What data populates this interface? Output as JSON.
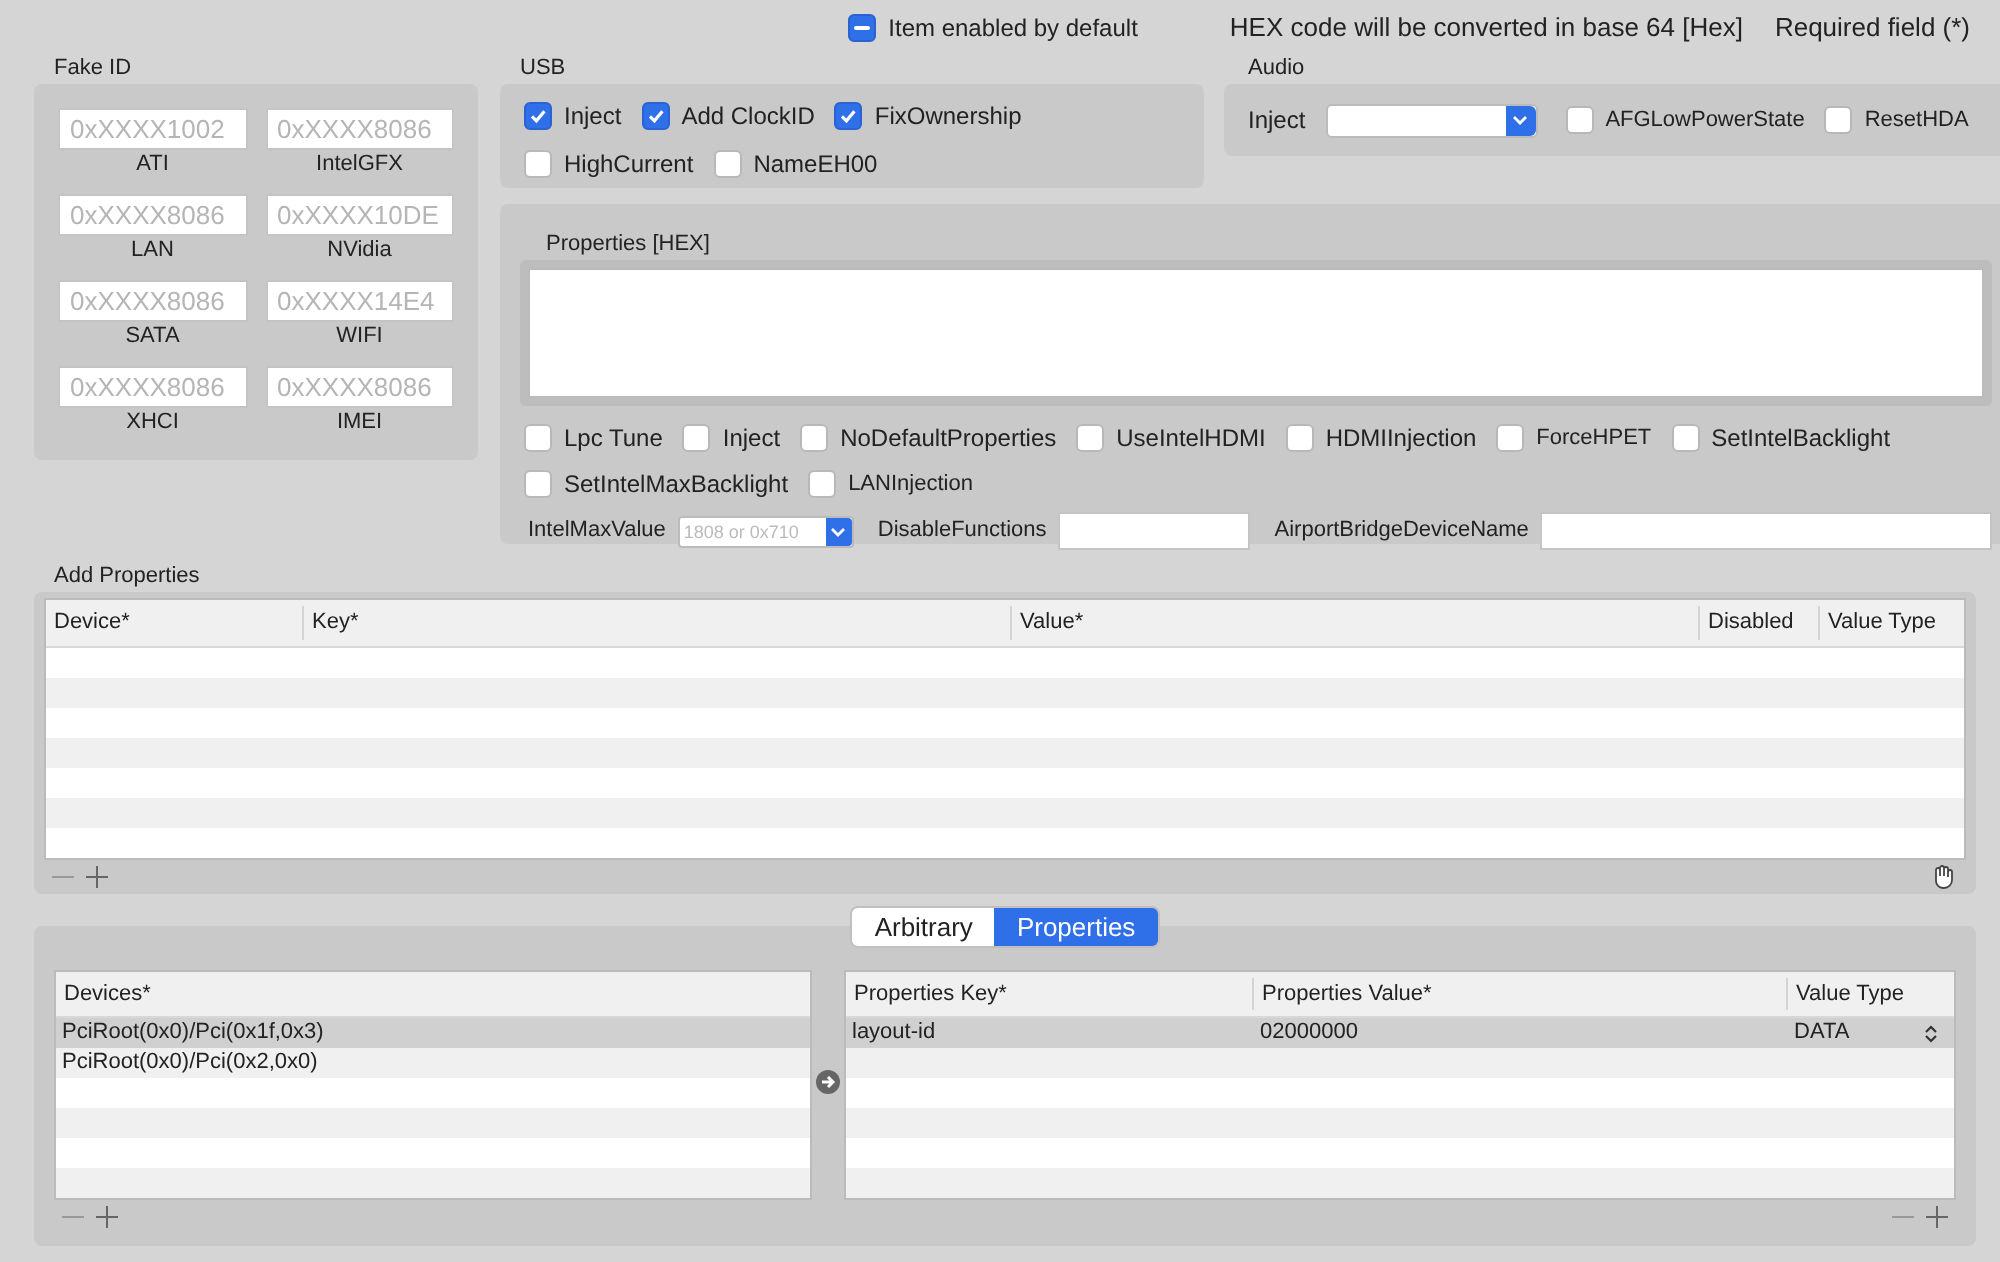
{
  "header": {
    "enabled": {
      "label": "Item enabled by default",
      "mixed": true
    },
    "notes": [
      "HEX code will be converted in base 64 [Hex]",
      "Required field (*)"
    ]
  },
  "fake_id": {
    "title": "Fake ID",
    "fields": [
      {
        "placeholder": "0xXXXX1002",
        "label": "ATI"
      },
      {
        "placeholder": "0xXXXX8086",
        "label": "IntelGFX"
      },
      {
        "placeholder": "0xXXXX8086",
        "label": "LAN"
      },
      {
        "placeholder": "0xXXXX10DE",
        "label": "NVidia"
      },
      {
        "placeholder": "0xXXXX8086",
        "label": "SATA"
      },
      {
        "placeholder": "0xXXXX14E4",
        "label": "WIFI"
      },
      {
        "placeholder": "0xXXXX8086",
        "label": "XHCI"
      },
      {
        "placeholder": "0xXXXX8086",
        "label": "IMEI"
      }
    ]
  },
  "usb": {
    "title": "USB",
    "options": [
      {
        "label": "Inject",
        "checked": true
      },
      {
        "label": "Add ClockID",
        "checked": true
      },
      {
        "label": "FixOwnership",
        "checked": true
      },
      {
        "label": "HighCurrent",
        "checked": false
      },
      {
        "label": "NameEH00",
        "checked": false
      }
    ]
  },
  "audio": {
    "title": "Audio",
    "inject_label": "Inject",
    "options": [
      {
        "label": "AFGLowPowerState",
        "checked": false
      },
      {
        "label": "ResetHDA",
        "checked": false
      }
    ]
  },
  "properties": {
    "title": "Properties [HEX]",
    "options": [
      {
        "label": "Lpc Tune",
        "checked": false
      },
      {
        "label": "Inject",
        "checked": false
      },
      {
        "label": "NoDefaultProperties",
        "checked": false
      },
      {
        "label": "UseIntelHDMI",
        "checked": false
      },
      {
        "label": "HDMIInjection",
        "checked": false
      },
      {
        "label": "ForceHPET",
        "checked": false
      },
      {
        "label": "SetIntelBacklight",
        "checked": false
      },
      {
        "label": "SetIntelMaxBacklight",
        "checked": false
      },
      {
        "label": "LANInjection",
        "checked": false
      }
    ],
    "fields": [
      {
        "label": "IntelMaxValue",
        "kind": "combo",
        "placeholder": "1808 or 0x710"
      },
      {
        "label": "DisableFunctions",
        "kind": "text"
      },
      {
        "label": "AirportBridgeDeviceName",
        "kind": "text"
      }
    ]
  },
  "add_properties": {
    "title": "Add Properties",
    "columns": [
      "Device*",
      "Key*",
      "Value*",
      "Disabled",
      "Value Type"
    ]
  },
  "tabs": [
    {
      "label": "Arbitrary",
      "selected": false
    },
    {
      "label": "Properties",
      "selected": true
    }
  ],
  "devices": {
    "column": "Devices*",
    "rows": [
      {
        "path": "PciRoot(0x0)/Pci(0x1f,0x3)",
        "selected": true
      },
      {
        "path": "PciRoot(0x0)/Pci(0x2,0x0)",
        "selected": false
      }
    ]
  },
  "device_properties": {
    "columns": [
      "Properties Key*",
      "Properties Value*",
      "Value Type"
    ],
    "rows": [
      {
        "key": "layout-id",
        "value": "02000000",
        "type": "DATA",
        "selected": true
      }
    ]
  }
}
